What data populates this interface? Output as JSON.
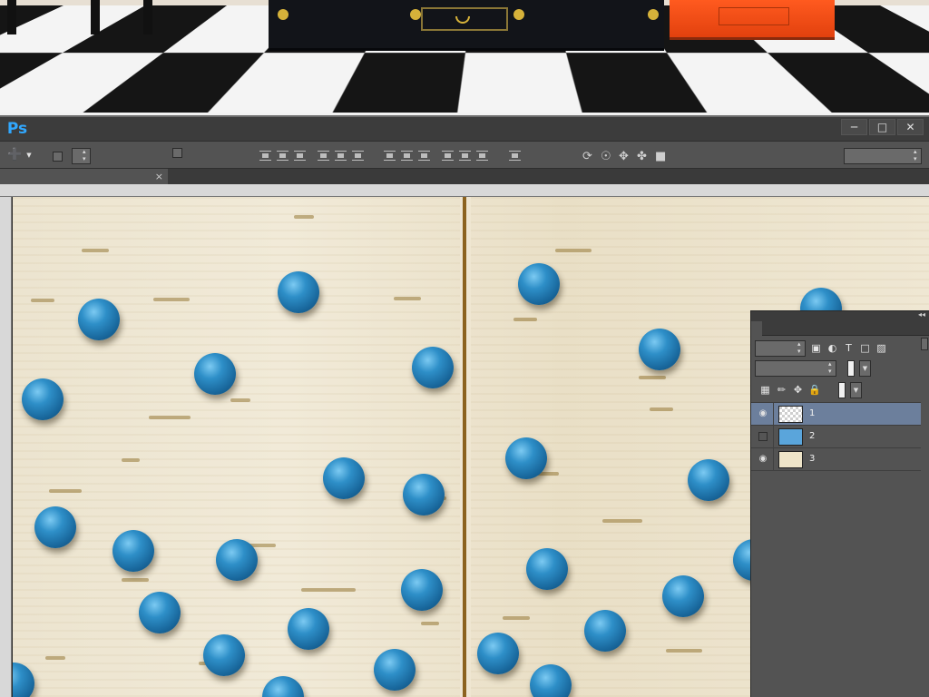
{
  "menu": {
    "items": []
  },
  "window_controls": {
    "minimize": "─",
    "restore": "□",
    "close": "✕"
  },
  "options_bar": {
    "auto_select_label": "",
    "auto_select_value": "",
    "show_transform_label": "",
    "mode_3d_label": "",
    "workspace": ""
  },
  "document": {
    "tab_title": "",
    "close_glyph": "×"
  },
  "ruler": {
    "top_labels": [],
    "left_labels": []
  },
  "layers_panel": {
    "title": "",
    "kind_filter": "",
    "blend_mode": "",
    "opacity_label": "",
    "opacity_value": "",
    "lock_label": "",
    "fill_label": "",
    "fill_value": "",
    "layers": [
      {
        "name": "1",
        "visible": true,
        "selected": true,
        "thumb": "transparent"
      },
      {
        "name": "2",
        "visible": false,
        "selected": false,
        "thumb": "blue"
      },
      {
        "name": "3",
        "visible": true,
        "selected": false,
        "thumb": "wood"
      }
    ]
  },
  "colors": {
    "app_dark": "#3c3c3c",
    "app_panel": "#535353",
    "ps_blue": "#31a8ff",
    "layer_selected": "#6c7f9c",
    "ball_blue": "#2e8fc8",
    "wood": "#ece4cf",
    "divider": "#8c6320"
  },
  "icons": [
    "move-tool-icon",
    "align-icon",
    "distribute-icon",
    "3d-rotate-icon",
    "eye-icon",
    "lock-icon",
    "brush-icon",
    "move-lock-icon"
  ]
}
